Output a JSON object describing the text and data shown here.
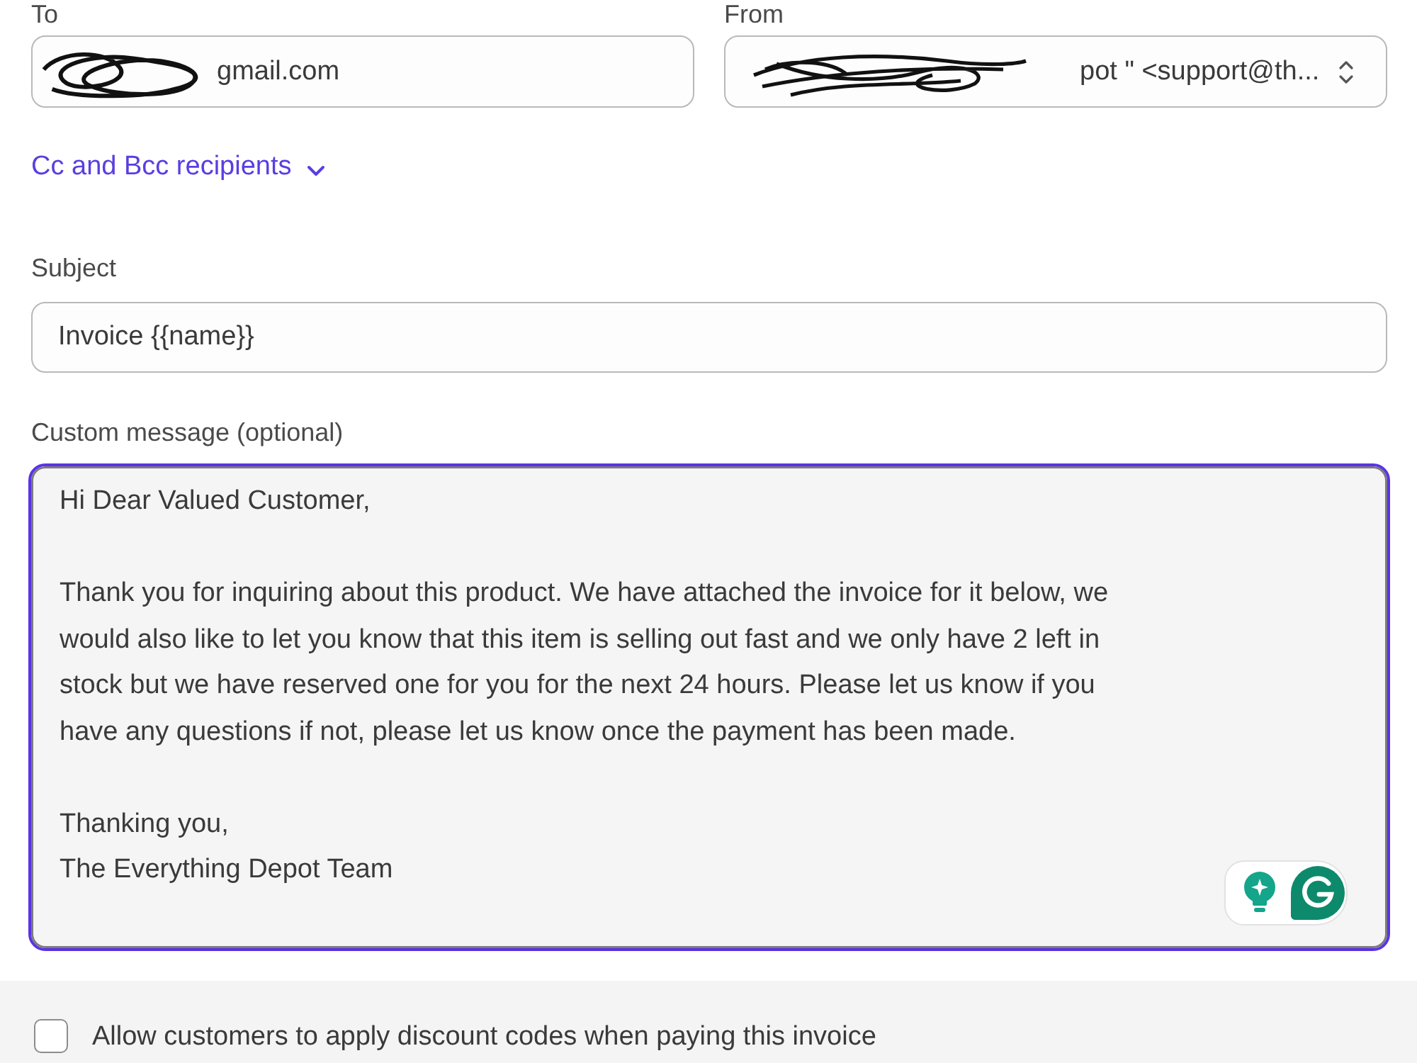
{
  "to": {
    "label": "To",
    "value": "gmail.com",
    "redacted": true
  },
  "from": {
    "label": "From",
    "value": "pot \" <support@th...",
    "redacted": true
  },
  "cc_link": {
    "label": "Cc and Bcc recipients",
    "expanded": false
  },
  "subject": {
    "label": "Subject",
    "value": "Invoice {{name}}"
  },
  "message": {
    "label": "Custom message (optional)",
    "focused": true,
    "paragraphs": [
      [
        "Hi Dear Valued Customer,"
      ],
      [
        "Thank you for inquiring about this product. We have attached the invoice for it below, we",
        "would also like to let you know that this item is selling out fast and we only have 2 left in",
        "stock but we have reserved one for you for the next 24 hours. Please let us know if you",
        "have any questions if not, please let us know once the payment has been made."
      ],
      [
        "Thanking you,",
        "The Everything Depot Team"
      ]
    ]
  },
  "options": [
    {
      "label": "Allow customers to apply discount codes when paying this invoice",
      "checked": false
    }
  ]
}
